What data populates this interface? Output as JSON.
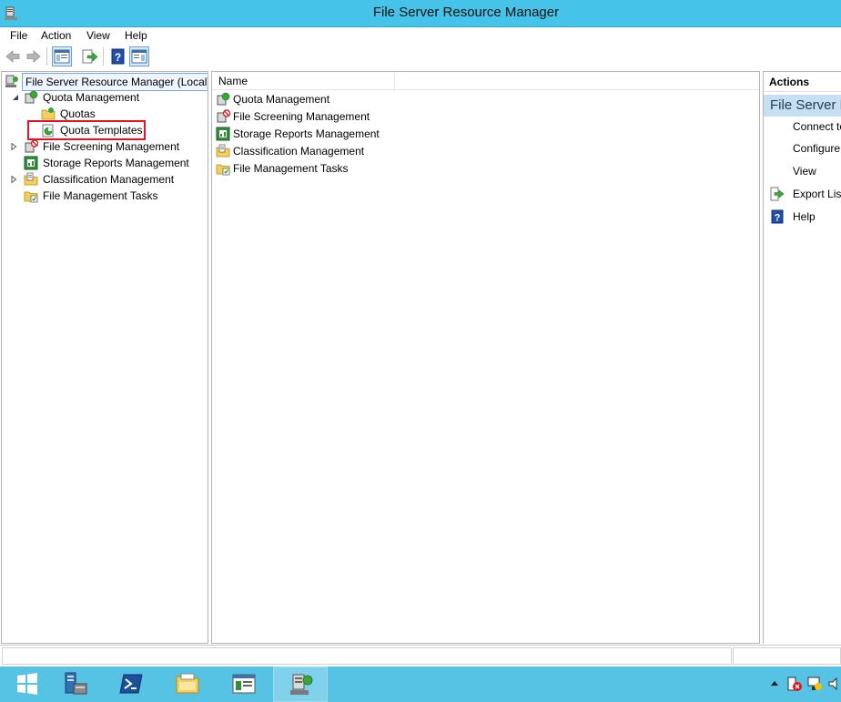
{
  "window": {
    "title": "File Server Resource Manager"
  },
  "menu": [
    "File",
    "Action",
    "View",
    "Help"
  ],
  "tree": {
    "root": "File Server Resource Manager (Local)",
    "items": [
      {
        "label": "Quota Management",
        "icon": "quota-management-icon",
        "expanded": true
      },
      {
        "label": "Quotas",
        "icon": "folder-icon"
      },
      {
        "label": "Quota Templates",
        "icon": "quota-template-icon",
        "highlighted": true
      },
      {
        "label": "File Screening Management",
        "icon": "file-screening-icon",
        "expanded": false
      },
      {
        "label": "Storage Reports Management",
        "icon": "storage-reports-icon"
      },
      {
        "label": "Classification Management",
        "icon": "classification-icon",
        "expanded": false
      },
      {
        "label": "File Management Tasks",
        "icon": "file-management-tasks-icon"
      }
    ]
  },
  "list": {
    "column": "Name",
    "items": [
      "Quota Management",
      "File Screening Management",
      "Storage Reports Management",
      "Classification Management",
      "File Management Tasks"
    ]
  },
  "actions": {
    "header": "Actions",
    "section": "File Server R",
    "items": [
      {
        "label": "Connect to",
        "icon": ""
      },
      {
        "label": "Configure",
        "icon": ""
      },
      {
        "label": "View",
        "icon": ""
      },
      {
        "label": "Export List",
        "icon": "export-icon"
      },
      {
        "label": "Help",
        "icon": "help-icon"
      }
    ]
  },
  "colors": {
    "title_bar": "#45c3e8",
    "taskbar": "#56c2e4",
    "highlight": "#e81123",
    "actions_section": "#c7dff0"
  }
}
